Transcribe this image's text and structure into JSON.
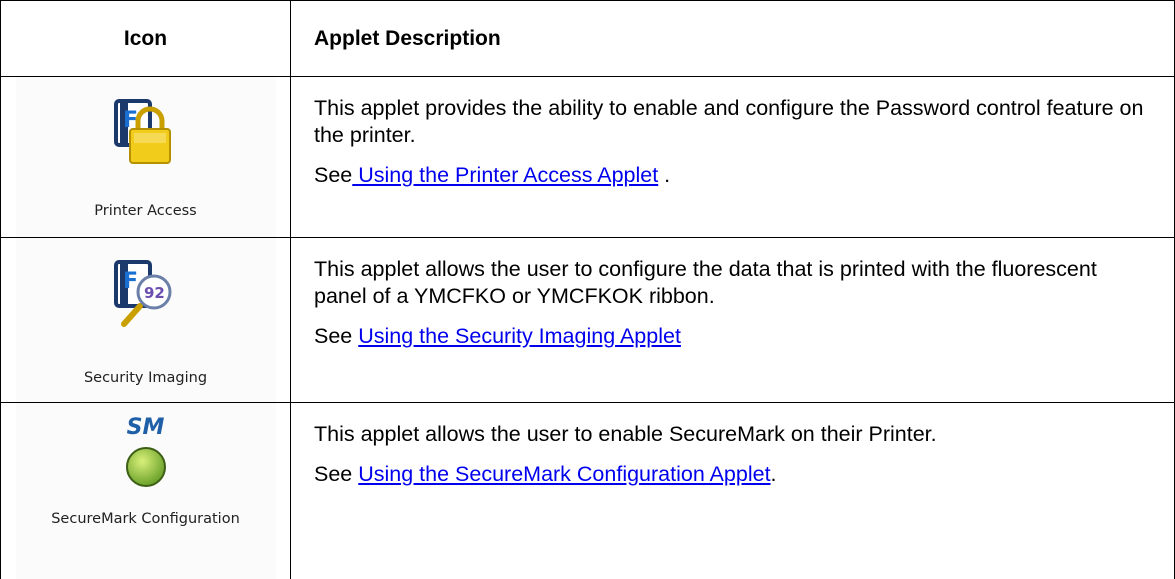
{
  "table": {
    "headers": {
      "icon": "Icon",
      "description": "Applet Description"
    },
    "rows": [
      {
        "icon_name": "printer-access-lock-icon",
        "icon_label": "Printer Access",
        "description": "This applet provides the ability to enable and configure the Password control feature on the printer.",
        "see_prefix": "See",
        "link_text": " Using the Printer Access Applet",
        "see_suffix": " ."
      },
      {
        "icon_name": "security-imaging-magnifier-icon",
        "icon_label": "Security Imaging",
        "description": "This applet allows the user to configure the data that is printed with the fluorescent panel of a YMCFKO or YMCFKOK ribbon.",
        "see_prefix": "See ",
        "link_text": "Using the Security Imaging Applet",
        "see_suffix": ""
      },
      {
        "icon_name": "securemark-green-circle-icon",
        "icon_badge": "SM",
        "icon_label": "SecureMark Configuration",
        "description": "This applet allows the user to enable SecureMark on their Printer.",
        "see_prefix": "See ",
        "link_text": "Using the SecureMark Configuration Applet",
        "see_suffix": "."
      }
    ]
  },
  "colors": {
    "link": "#0000ee",
    "lock_gold": "#f2cc1a",
    "sm_blue": "#1f5fa8",
    "sm_green": "#8dc63f"
  }
}
